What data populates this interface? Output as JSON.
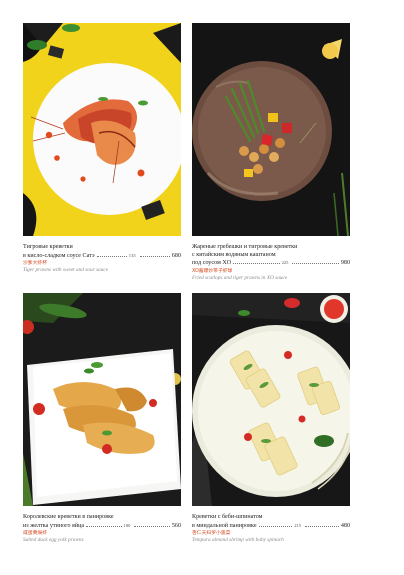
{
  "dishes": [
    {
      "name_line1": "Тигровые креветки",
      "name_line2": "в кисло-сладком соусе Сатэ",
      "weight": "135",
      "price": "680",
      "chinese": "沙爹大虾杯",
      "english": "Tiger prawns with sweet and sour sauce"
    },
    {
      "name_line1": "Жареные гребешки и тигровые креветки",
      "name_line2": "с китайским водяным каштаном",
      "name_line3": "под соусом XO",
      "weight": "225",
      "price": "980",
      "chinese": "XO酱爆炒带子虾球",
      "english": "Fried scallops and tiger prawns in XO sauce"
    },
    {
      "name_line1": "Королевские креветки в панировке",
      "name_line2": "из желтка утиного яйца",
      "weight": "180",
      "price": "560",
      "chinese": "咸蛋黄焗虾",
      "english": "Salted duck egg yolk prawns"
    },
    {
      "name_line1": "Креветки с беби-шпинатом",
      "name_line2": "в миндальной панировке",
      "weight": "215",
      "price": "480",
      "chinese": "杏仁天妇罗小菠菜",
      "english": "Tempura almond shrimp with baby spinach"
    }
  ],
  "colors": {
    "accent": "#d64a21",
    "text": "#222222",
    "muted": "#8a8a8a",
    "plate_yellow": "#f2d31b"
  }
}
